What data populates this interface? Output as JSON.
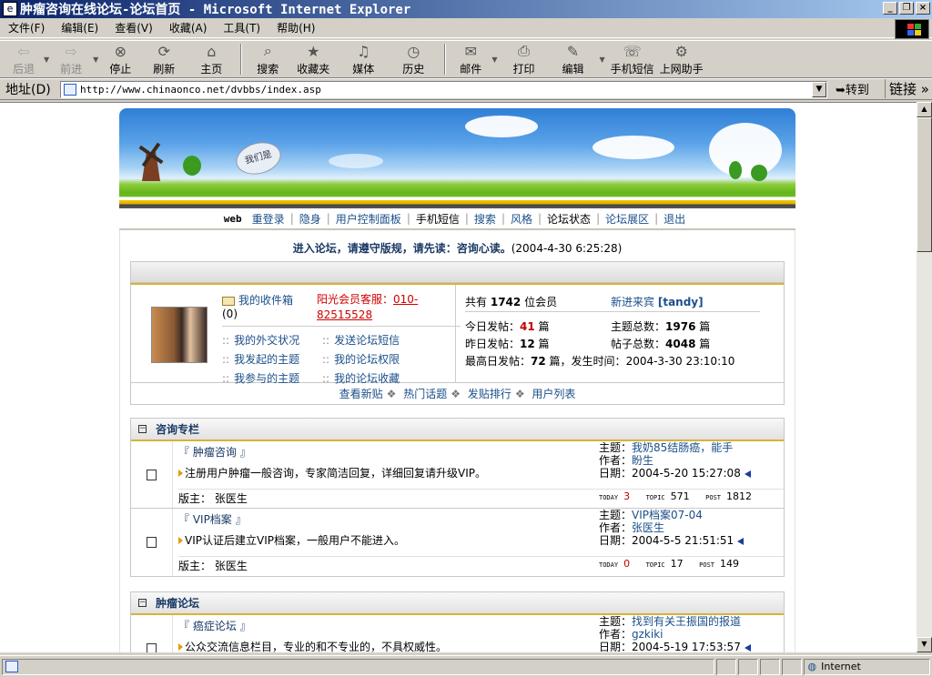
{
  "window": {
    "title": "肿瘤咨询在线论坛-论坛首页 - Microsoft Internet Explorer",
    "controls": [
      "_",
      "❐",
      "×"
    ]
  },
  "menu": [
    "文件(F)",
    "编辑(E)",
    "查看(V)",
    "收藏(A)",
    "工具(T)",
    "帮助(H)"
  ],
  "toolbar": {
    "back": "后退",
    "forward": "前进",
    "stop": "停止",
    "refresh": "刷新",
    "home": "主页",
    "search": "搜索",
    "favorites": "收藏夹",
    "media": "媒体",
    "history": "历史",
    "mail": "邮件",
    "print": "打印",
    "edit": "编辑",
    "sms": "手机短信",
    "helper": "上网助手"
  },
  "address": {
    "label": "地址(D)",
    "url": "http://www.chinaonco.net/dvbbs/index.asp",
    "go": "转到",
    "links": "链接 »"
  },
  "banner": {
    "badge": "我们是"
  },
  "nav": {
    "web": "web",
    "items": [
      "重登录",
      "隐身",
      "用户控制面板",
      "手机短信",
      "搜索",
      "风格",
      "论坛状态",
      "论坛展区",
      "退出"
    ]
  },
  "notice": {
    "text": "进入论坛，请遵守版规，请先读：咨询心读。",
    "time": "(2004-4-30 6:25:28)"
  },
  "user": {
    "inbox": "我的收件箱",
    "inbox_count": "(0)",
    "service_label": "阳光会员客服：",
    "service_phone": "010-82515528",
    "links": [
      "我的外交状况",
      "发送论坛短信",
      "我发起的主题",
      "我的论坛权限",
      "我参与的主题",
      "我的论坛收藏"
    ]
  },
  "stats": {
    "members_prefix": "共有",
    "members": "1742",
    "members_suffix": "位会员",
    "newest_label": "新进来宾",
    "newest": "[tandy]",
    "today_label": "今日发帖：",
    "today": "41",
    "today_unit": "篇",
    "topics_label": "主题总数：",
    "topics": "1976",
    "topics_unit": "篇",
    "yesterday_label": "昨日发帖：",
    "yesterday": "12",
    "yesterday_unit": "篇",
    "posts_label": "帖子总数：",
    "posts": "4048",
    "posts_unit": "篇",
    "max_label": "最高日发帖：",
    "max": "72",
    "max_suffix": "篇，发生时间：",
    "max_time": "2004-3-30 23:10:10"
  },
  "quick": [
    "查看新贴",
    "热门话题",
    "发贴排行",
    "用户列表"
  ],
  "sections": [
    {
      "title": "咨询专栏",
      "forums": [
        {
          "name": "『 肿瘤咨询 』",
          "desc": "注册用户肿瘤一般咨询，专家简洁回复，详细回复请升级VIP。",
          "mod_label": "版主：",
          "mod": "张医生",
          "topic_label": "主题：",
          "topic": "我奶85结肠癌，能手",
          "author_label": "作者：",
          "author": "盼生",
          "date_label": "日期：",
          "date": "2004-5-20 15:27:08",
          "today_k": "TODAY",
          "today": "3",
          "topic_k": "TOPIC",
          "topics": "571",
          "post_k": "POST",
          "posts": "1812"
        },
        {
          "name": "『 VIP档案 』",
          "desc": "VIP认证后建立VIP档案，一般用户不能进入。",
          "mod_label": "版主：",
          "mod": "张医生",
          "topic_label": "主题：",
          "topic": "VIP档案07-04",
          "author_label": "作者：",
          "author": "张医生",
          "date_label": "日期：",
          "date": "2004-5-5 21:51:51",
          "today_k": "TODAY",
          "today": "0",
          "topic_k": "TOPIC",
          "topics": "17",
          "post_k": "POST",
          "posts": "149"
        }
      ]
    },
    {
      "title": "肿瘤论坛",
      "forums": [
        {
          "name": "『 癌症论坛 』",
          "desc": "公众交流信息栏目，专业的和不专业的，不具权威性。",
          "topic_label": "主题：",
          "topic": "找到有关王振国的报道",
          "author_label": "作者：",
          "author": "gzkiki",
          "date_label": "日期：",
          "date": "2004-5-19 17:53:57"
        }
      ]
    }
  ],
  "status": {
    "zone": "Internet"
  }
}
